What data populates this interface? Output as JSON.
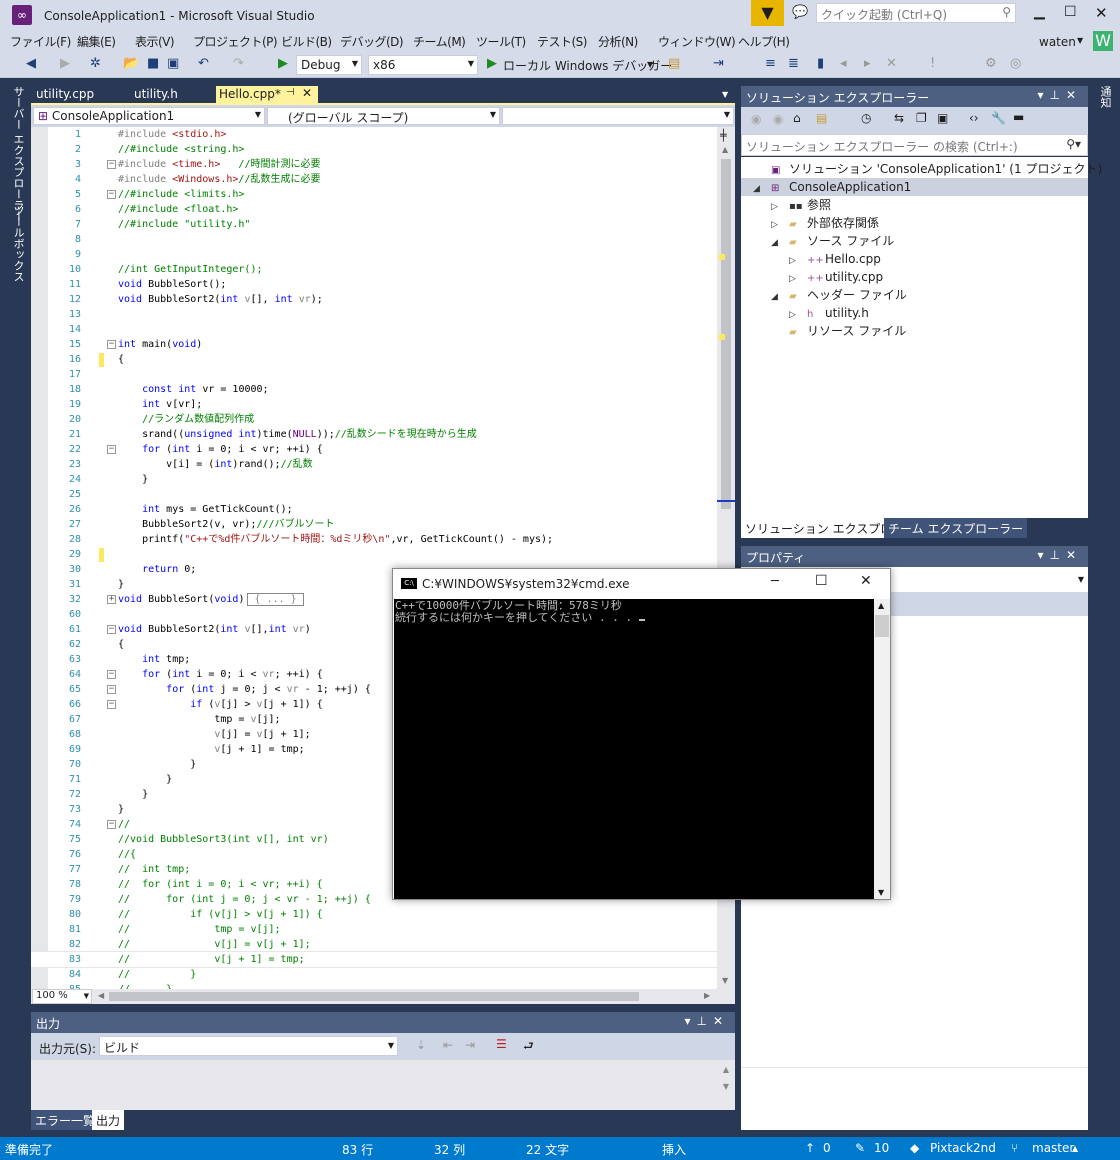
{
  "window": {
    "title": "ConsoleApplication1 - Microsoft Visual Studio",
    "quick_launch_placeholder": "クイック起動 (Ctrl+Q)",
    "user": "waten",
    "avatar_letter": "W",
    "colors": {
      "accent": "#007acc",
      "filter": "#e8b600",
      "avatar": "#3cb371"
    }
  },
  "menu": [
    "ファイル(F)",
    "編集(E)",
    "表示(V)",
    "プロジェクト(P)",
    "ビルド(B)",
    "デバッグ(D)",
    "チーム(M)",
    "ツール(T)",
    "テスト(S)",
    "分析(N)",
    "ウィンドウ(W)",
    "ヘルプ(H)"
  ],
  "toolbar": {
    "config": "Debug",
    "platform": "x86",
    "debugger": "ローカル Windows デバッガー"
  },
  "left_strip": [
    "サーバー エクスプローラー",
    "ツールボックス"
  ],
  "right_strip": [
    "通知"
  ],
  "doc_tabs": [
    {
      "label": "utility.cpp"
    },
    {
      "label": "utility.h"
    },
    {
      "label": "Hello.cpp*",
      "active": true
    }
  ],
  "nav": {
    "project": "ConsoleApplication1",
    "scope": "(グローバル スコープ)",
    "member": ""
  },
  "editor": {
    "zoom": "100 %",
    "lines": [
      {
        "n": "1",
        "t": [
          [
            "pp",
            "#include "
          ],
          [
            "str",
            "<stdio.h>"
          ]
        ]
      },
      {
        "n": "2",
        "t": [
          [
            "cm",
            "//#include <string.h>"
          ]
        ]
      },
      {
        "n": "3",
        "fold": "−",
        "t": [
          [
            "pp",
            "#include "
          ],
          [
            "str",
            "<time.h>"
          ],
          [
            "cm",
            "   //時間計測に必要"
          ]
        ]
      },
      {
        "n": "4",
        "t": [
          [
            "pp",
            "#include "
          ],
          [
            "str",
            "<Windows.h>"
          ],
          [
            "cm",
            "//乱数生成に必要"
          ]
        ]
      },
      {
        "n": "5",
        "fold": "−",
        "t": [
          [
            "cm",
            "//#include <limits.h>"
          ]
        ]
      },
      {
        "n": "6",
        "t": [
          [
            "cm",
            "//#include <float.h>"
          ]
        ]
      },
      {
        "n": "7",
        "t": [
          [
            "cm",
            "//#include \"utility.h\""
          ]
        ]
      },
      {
        "n": "8",
        "t": []
      },
      {
        "n": "9",
        "t": []
      },
      {
        "n": "10",
        "t": [
          [
            "cm",
            "//int GetInputInteger();"
          ]
        ]
      },
      {
        "n": "11",
        "t": [
          [
            "kw",
            "void"
          ],
          [
            "pl",
            " BubbleSort();"
          ]
        ]
      },
      {
        "n": "12",
        "t": [
          [
            "kw",
            "void"
          ],
          [
            "pl",
            " BubbleSort2("
          ],
          [
            "kw",
            "int"
          ],
          [
            "pl",
            " "
          ],
          [
            "par",
            "v"
          ],
          [
            "pl",
            "[], "
          ],
          [
            "kw",
            "int"
          ],
          [
            "pl",
            " "
          ],
          [
            "par",
            "vr"
          ],
          [
            "pl",
            ");"
          ]
        ]
      },
      {
        "n": "13",
        "t": []
      },
      {
        "n": "14",
        "t": []
      },
      {
        "n": "15",
        "fold": "−",
        "t": [
          [
            "kw",
            "int"
          ],
          [
            "pl",
            " main("
          ],
          [
            "kw",
            "void"
          ],
          [
            "pl",
            ")"
          ]
        ]
      },
      {
        "n": "16",
        "changed": true,
        "t": [
          [
            "pl",
            "{"
          ]
        ]
      },
      {
        "n": "17",
        "t": []
      },
      {
        "n": "18",
        "t": [
          [
            "pl",
            "    "
          ],
          [
            "kw",
            "const"
          ],
          [
            "pl",
            " "
          ],
          [
            "kw",
            "int"
          ],
          [
            "pl",
            " vr = 10000;"
          ]
        ]
      },
      {
        "n": "19",
        "t": [
          [
            "pl",
            "    "
          ],
          [
            "kw",
            "int"
          ],
          [
            "pl",
            " v[vr];"
          ]
        ]
      },
      {
        "n": "20",
        "t": [
          [
            "pl",
            "    "
          ],
          [
            "cm",
            "//ランダム数値配列作成"
          ]
        ]
      },
      {
        "n": "21",
        "t": [
          [
            "pl",
            "    srand(("
          ],
          [
            "kw",
            "unsigned int"
          ],
          [
            "pl",
            ")time("
          ],
          [
            "mac",
            "NULL"
          ],
          [
            "pl",
            "));"
          ],
          [
            "cm",
            "//乱数シードを現在時から生成"
          ]
        ]
      },
      {
        "n": "22",
        "fold": "−",
        "t": [
          [
            "pl",
            "    "
          ],
          [
            "kw",
            "for"
          ],
          [
            "pl",
            " ("
          ],
          [
            "kw",
            "int"
          ],
          [
            "pl",
            " i = 0; i < vr; ++i) {"
          ]
        ]
      },
      {
        "n": "23",
        "t": [
          [
            "pl",
            "        v[i] = ("
          ],
          [
            "kw",
            "int"
          ],
          [
            "pl",
            ")rand();"
          ],
          [
            "cm",
            "//乱数"
          ]
        ]
      },
      {
        "n": "24",
        "t": [
          [
            "pl",
            "    }"
          ]
        ]
      },
      {
        "n": "25",
        "t": []
      },
      {
        "n": "26",
        "t": [
          [
            "pl",
            "    "
          ],
          [
            "kw",
            "int"
          ],
          [
            "pl",
            " mys = GetTickCount();"
          ]
        ]
      },
      {
        "n": "27",
        "t": [
          [
            "pl",
            "    BubbleSort2(v, vr);"
          ],
          [
            "cm",
            "///バブルソート"
          ]
        ]
      },
      {
        "n": "28",
        "t": [
          [
            "pl",
            "    printf("
          ],
          [
            "str",
            "\"C++で%d件バブルソート時間：%dミリ秒\\n\""
          ],
          [
            "pl",
            ",vr, GetTickCount() - mys);"
          ]
        ]
      },
      {
        "n": "29",
        "changed": true,
        "t": []
      },
      {
        "n": "30",
        "t": [
          [
            "pl",
            "    "
          ],
          [
            "kw",
            "return"
          ],
          [
            "pl",
            " 0;"
          ]
        ]
      },
      {
        "n": "31",
        "t": [
          [
            "pl",
            "}"
          ]
        ]
      },
      {
        "n": "32",
        "fold": "+",
        "t": [
          [
            "kw",
            "void"
          ],
          [
            "pl",
            " BubbleSort("
          ],
          [
            "kw",
            "void"
          ],
          [
            "pl",
            ")"
          ],
          [
            "col",
            "{ ... }"
          ]
        ]
      },
      {
        "n": "60",
        "t": []
      },
      {
        "n": "61",
        "fold": "−",
        "t": [
          [
            "kw",
            "void"
          ],
          [
            "pl",
            " BubbleSort2("
          ],
          [
            "kw",
            "int"
          ],
          [
            "pl",
            " "
          ],
          [
            "par",
            "v"
          ],
          [
            "pl",
            "[],"
          ],
          [
            "kw",
            "int"
          ],
          [
            "pl",
            " "
          ],
          [
            "par",
            "vr"
          ],
          [
            "pl",
            ")"
          ]
        ]
      },
      {
        "n": "62",
        "t": [
          [
            "pl",
            "{"
          ]
        ]
      },
      {
        "n": "63",
        "t": [
          [
            "pl",
            "    "
          ],
          [
            "kw",
            "int"
          ],
          [
            "pl",
            " tmp;"
          ]
        ]
      },
      {
        "n": "64",
        "fold": "−",
        "t": [
          [
            "pl",
            "    "
          ],
          [
            "kw",
            "for"
          ],
          [
            "pl",
            " ("
          ],
          [
            "kw",
            "int"
          ],
          [
            "pl",
            " i = 0; i < "
          ],
          [
            "par",
            "vr"
          ],
          [
            "pl",
            "; ++i) {"
          ]
        ]
      },
      {
        "n": "65",
        "fold": "−",
        "t": [
          [
            "pl",
            "        "
          ],
          [
            "kw",
            "for"
          ],
          [
            "pl",
            " ("
          ],
          [
            "kw",
            "int"
          ],
          [
            "pl",
            " j = 0; j < "
          ],
          [
            "par",
            "vr"
          ],
          [
            "pl",
            " - 1; ++j) {"
          ]
        ]
      },
      {
        "n": "66",
        "fold": "−",
        "t": [
          [
            "pl",
            "            "
          ],
          [
            "kw",
            "if"
          ],
          [
            "pl",
            " ("
          ],
          [
            "par",
            "v"
          ],
          [
            "pl",
            "[j] > "
          ],
          [
            "par",
            "v"
          ],
          [
            "pl",
            "[j + 1]) {"
          ]
        ]
      },
      {
        "n": "67",
        "t": [
          [
            "pl",
            "                tmp = "
          ],
          [
            "par",
            "v"
          ],
          [
            "pl",
            "[j];"
          ]
        ]
      },
      {
        "n": "68",
        "t": [
          [
            "pl",
            "                "
          ],
          [
            "par",
            "v"
          ],
          [
            "pl",
            "[j] = "
          ],
          [
            "par",
            "v"
          ],
          [
            "pl",
            "[j + 1];"
          ]
        ]
      },
      {
        "n": "69",
        "t": [
          [
            "pl",
            "                "
          ],
          [
            "par",
            "v"
          ],
          [
            "pl",
            "[j + 1] = tmp;"
          ]
        ]
      },
      {
        "n": "70",
        "t": [
          [
            "pl",
            "            }"
          ]
        ]
      },
      {
        "n": "71",
        "t": [
          [
            "pl",
            "        }"
          ]
        ]
      },
      {
        "n": "72",
        "t": [
          [
            "pl",
            "    }"
          ]
        ]
      },
      {
        "n": "73",
        "t": [
          [
            "pl",
            "}"
          ]
        ]
      },
      {
        "n": "74",
        "fold": "−",
        "t": [
          [
            "cm",
            "//"
          ]
        ]
      },
      {
        "n": "75",
        "t": [
          [
            "cm",
            "//void BubbleSort3(int v[], int vr)"
          ]
        ]
      },
      {
        "n": "76",
        "t": [
          [
            "cm",
            "//{"
          ]
        ]
      },
      {
        "n": "77",
        "t": [
          [
            "cm",
            "//  int tmp;"
          ]
        ]
      },
      {
        "n": "78",
        "t": [
          [
            "cm",
            "//  for (int i = 0; i < vr; ++i) {"
          ]
        ]
      },
      {
        "n": "79",
        "t": [
          [
            "cm",
            "//      for (int j = 0; j < vr - 1; ++j) {"
          ]
        ]
      },
      {
        "n": "80",
        "t": [
          [
            "cm",
            "//          if (v[j] > v[j + 1]) {"
          ]
        ]
      },
      {
        "n": "81",
        "t": [
          [
            "cm",
            "//              tmp = v[j];"
          ]
        ]
      },
      {
        "n": "82",
        "t": [
          [
            "cm",
            "//              v[j] = v[j + 1];"
          ]
        ]
      },
      {
        "n": "83",
        "current": true,
        "t": [
          [
            "cm",
            "//              v[j + 1] = tmp;"
          ]
        ]
      },
      {
        "n": "84",
        "t": [
          [
            "cm",
            "//          }"
          ]
        ]
      },
      {
        "n": "85",
        "t": [
          [
            "cm",
            "//      }"
          ]
        ]
      }
    ]
  },
  "output": {
    "title": "出力",
    "source_label": "出力元(S):",
    "source_value": "ビルド",
    "tabs": [
      "エラー一覧",
      "出力"
    ]
  },
  "solution_explorer": {
    "title": "ソリューション エクスプローラー",
    "search_placeholder": "ソリューション エクスプローラー の検索 (Ctrl+:)",
    "tree": [
      {
        "label": "ソリューション 'ConsoleApplication1' (1 プロジェクト)",
        "depth": 0,
        "expander": "",
        "icon": "solution-icon"
      },
      {
        "label": "ConsoleApplication1",
        "depth": 0,
        "expander": "◢",
        "icon": "project-icon",
        "selected": true
      },
      {
        "label": "参照",
        "depth": 1,
        "expander": "▷",
        "icon": "references-icon"
      },
      {
        "label": "外部依存関係",
        "depth": 1,
        "expander": "▷",
        "icon": "folder-icon"
      },
      {
        "label": "ソース ファイル",
        "depth": 1,
        "expander": "◢",
        "icon": "folder-icon"
      },
      {
        "label": "Hello.cpp",
        "depth": 2,
        "expander": "▷",
        "icon": "cpp-file-icon"
      },
      {
        "label": "utility.cpp",
        "depth": 2,
        "expander": "▷",
        "icon": "cpp-file-icon"
      },
      {
        "label": "ヘッダー ファイル",
        "depth": 1,
        "expander": "◢",
        "icon": "folder-icon"
      },
      {
        "label": "utility.h",
        "depth": 2,
        "expander": "▷",
        "icon": "header-file-icon"
      },
      {
        "label": "リソース ファイル",
        "depth": 1,
        "expander": "",
        "icon": "folder-icon"
      }
    ],
    "tabs": [
      "ソリューション エクスプローラー",
      "チーム エクスプローラー"
    ]
  },
  "properties": {
    "title": "プロパティ"
  },
  "cmd": {
    "title": "C:¥WINDOWS¥system32¥cmd.exe",
    "lines": [
      "C++で10000件バブルソート時間：578ミリ秒",
      "続行するには何かキーを押してください . . . "
    ]
  },
  "status": {
    "ready": "準備完了",
    "line": "83 行",
    "col": "32 列",
    "chars": "22 文字",
    "mode": "挿入",
    "pushes": "0",
    "edits": "10",
    "repo": "Pixtack2nd",
    "branch": "master"
  }
}
